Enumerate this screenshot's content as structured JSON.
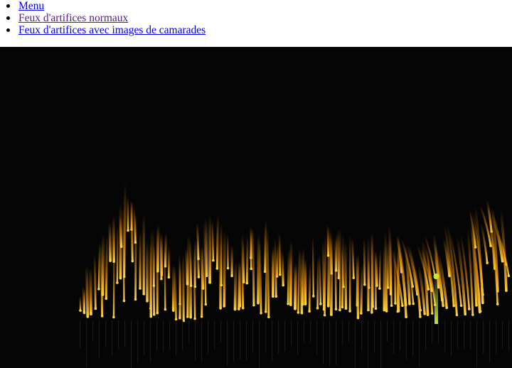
{
  "nav": {
    "items": [
      {
        "label": "Menu",
        "color": "#0000ee"
      },
      {
        "label": "Feux d'artifices normaux",
        "color": "#551a8b"
      },
      {
        "label": "Feux d'artifices avec images de camarades",
        "color": "#0000ee"
      }
    ]
  },
  "canvas": {
    "background": "#050505",
    "spark_color": "#ff9e0a",
    "spark_core_color": "#ffd23c",
    "accent_color": "#c8e632"
  }
}
